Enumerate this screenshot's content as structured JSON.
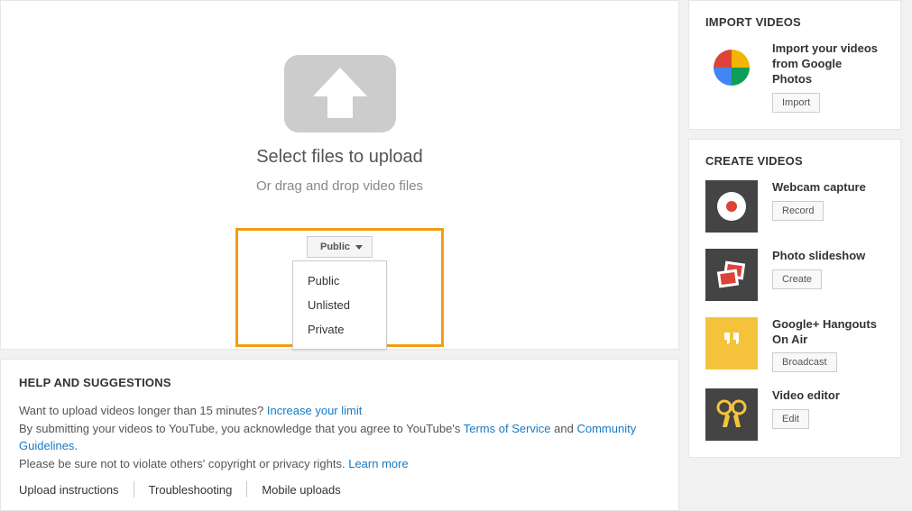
{
  "upload": {
    "heading": "Select files to upload",
    "sub": "Or drag and drop video files",
    "privacy_selected": "Public",
    "options": [
      "Public",
      "Unlisted",
      "Private"
    ]
  },
  "help": {
    "heading": "HELP AND SUGGESTIONS",
    "line1_pre": "Want to upload videos longer than 15 minutes? ",
    "line1_link": "Increase your limit",
    "line2_pre": "By submitting your videos to YouTube, you acknowledge that you agree to YouTube's ",
    "tos": "Terms of Service",
    "and": " and ",
    "cg": "Community Guidelines",
    "period": ".",
    "line3_pre": "Please be sure not to violate others' copyright or privacy rights. ",
    "learn": "Learn more",
    "links": [
      "Upload instructions",
      "Troubleshooting",
      "Mobile uploads"
    ]
  },
  "import": {
    "heading": "IMPORT VIDEOS",
    "title": "Import your videos from Google Photos",
    "button": "Import"
  },
  "create": {
    "heading": "CREATE VIDEOS",
    "items": [
      {
        "title": "Webcam capture",
        "button": "Record"
      },
      {
        "title": "Photo slideshow",
        "button": "Create"
      },
      {
        "title": "Google+ Hangouts On Air",
        "button": "Broadcast"
      },
      {
        "title": "Video editor",
        "button": "Edit"
      }
    ]
  }
}
